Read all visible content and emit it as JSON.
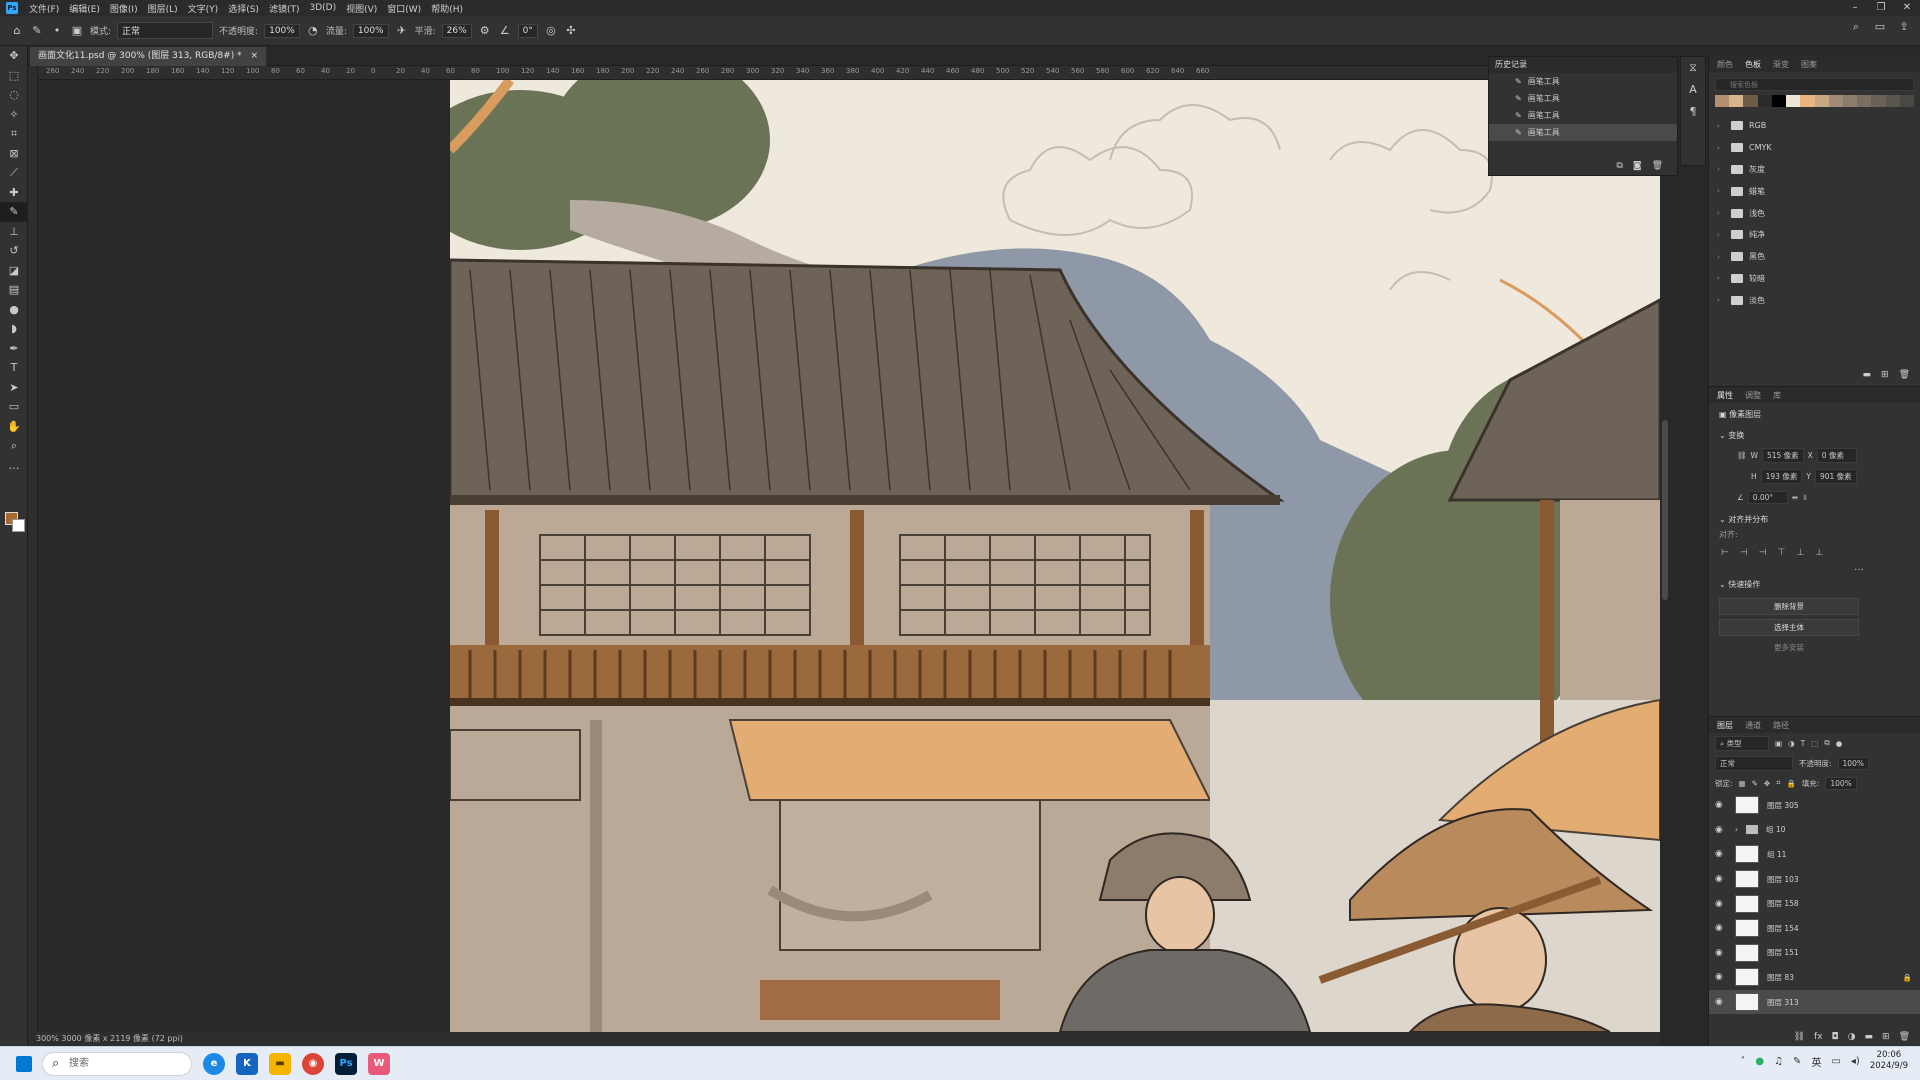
{
  "menubar": {
    "items": [
      "文件(F)",
      "编辑(E)",
      "图像(I)",
      "图层(L)",
      "文字(Y)",
      "选择(S)",
      "滤镜(T)",
      "3D(D)",
      "视图(V)",
      "窗口(W)",
      "帮助(H)"
    ]
  },
  "options": {
    "mode_label": "模式:",
    "mode_value": "正常",
    "opacity_label": "不透明度:",
    "opacity_value": "100%",
    "flow_label": "流量:",
    "flow_value": "100%",
    "smooth_label": "平滑:",
    "smooth_value": "26%",
    "angle_value": "0°"
  },
  "document": {
    "tab_title": "画面文化11.psd @ 300% (图层 313, RGB/8#) *",
    "ruler_labels": [
      "260",
      "240",
      "220",
      "200",
      "180",
      "160",
      "140",
      "120",
      "100",
      "80",
      "60",
      "40",
      "20",
      "0",
      "20",
      "40",
      "60",
      "80",
      "100",
      "120",
      "140",
      "160",
      "180",
      "200",
      "220",
      "240",
      "260",
      "280",
      "300",
      "320",
      "340",
      "360",
      "380",
      "400",
      "420",
      "440",
      "460",
      "480",
      "500",
      "520",
      "540",
      "560",
      "580",
      "600",
      "620",
      "640",
      "660"
    ],
    "status": "300%    3000 像素 x 2119 像素 (72 ppi)"
  },
  "history": {
    "title": "历史记录",
    "items": [
      "画笔工具",
      "画笔工具",
      "画笔工具",
      "画笔工具"
    ],
    "selected_index": 3
  },
  "swatches": {
    "tabs": [
      "颜色",
      "色板",
      "渐变",
      "图案"
    ],
    "active_tab": "色板",
    "search_placeholder": "搜索色板",
    "colors": [
      "#b49070",
      "#d8b48c",
      "#6e5a48",
      "#2a2a2a",
      "#000000",
      "#f0e6d8",
      "#e8b482",
      "#c8a880",
      "#a08a78",
      "#8c7c6c",
      "#7a6e62",
      "#6a6258",
      "#5a564e",
      "#4a4844"
    ],
    "folders": [
      "RGB",
      "CMYK",
      "灰度",
      "蜡笔",
      "浅色",
      "纯净",
      "黑色",
      "较暗",
      "淡色"
    ]
  },
  "properties": {
    "tabs": [
      "属性",
      "调整",
      "库"
    ],
    "active_tab": "属性",
    "type_label": "像素图层",
    "transform_title": "变换",
    "w": "515 像素",
    "x": "0 像素",
    "h": "193 像素",
    "y": "901 像素",
    "angle": "0.00°",
    "align_title": "对齐并分布",
    "align_sub": "对齐:",
    "quick_title": "快速操作",
    "btn_remove_bg": "删除背景",
    "btn_select_subject": "选择主体",
    "btn_more": "更多安装"
  },
  "layers": {
    "tabs": [
      "图层",
      "通道",
      "路径"
    ],
    "active_tab": "图层",
    "filter_label": "类型",
    "blend_mode": "正常",
    "opacity_label": "不透明度:",
    "opacity_value": "100%",
    "lock_label": "锁定:",
    "fill_label": "填充:",
    "fill_value": "100%",
    "items": [
      {
        "name": "图层 305",
        "type": "layer"
      },
      {
        "name": "组 10",
        "type": "group"
      },
      {
        "name": "组 11",
        "type": "layer"
      },
      {
        "name": "图层 103",
        "type": "layer"
      },
      {
        "name": "图层 158",
        "type": "layer"
      },
      {
        "name": "图层 154",
        "type": "layer"
      },
      {
        "name": "图层 151",
        "type": "layer"
      },
      {
        "name": "图层 83",
        "type": "layer"
      },
      {
        "name": "图层 313",
        "type": "layer"
      }
    ],
    "selected": "图层 313"
  },
  "taskbar": {
    "search_placeholder": "搜索",
    "time": "20:06",
    "date": "2024/9/9"
  },
  "colors": {
    "foreground": "#a86a2e",
    "background": "#ffffff",
    "accent": "#31a8ff"
  }
}
